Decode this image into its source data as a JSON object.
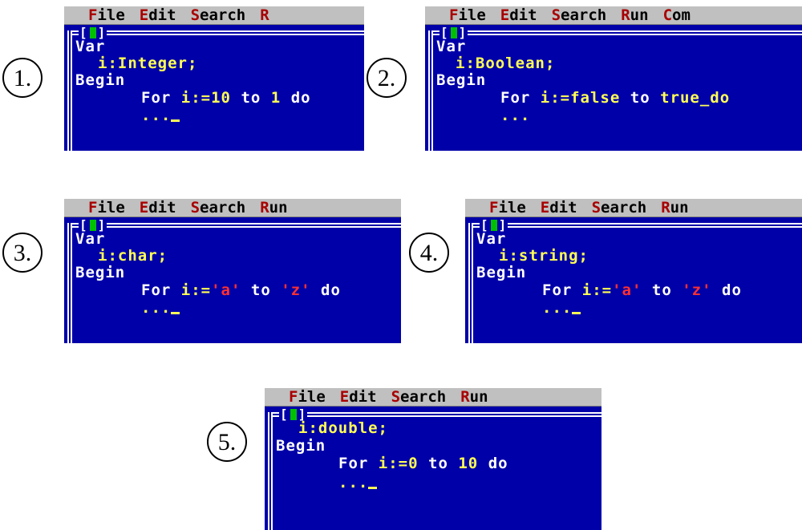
{
  "panels": [
    {
      "number": "1.",
      "menu": [
        {
          "hotkey": "F",
          "rest": "ile"
        },
        {
          "hotkey": "E",
          "rest": "dit"
        },
        {
          "hotkey": "S",
          "rest": "earch"
        },
        {
          "hotkey": "R",
          "rest": ""
        }
      ],
      "line1": "Var",
      "decl": "i:Integer;",
      "begin": "Begin",
      "for_kw": "For",
      "for_var": "i:=10",
      "for_to": "to",
      "for_end": "1",
      "for_do": "do",
      "dots": "..."
    },
    {
      "number": "2.",
      "menu": [
        {
          "hotkey": "F",
          "rest": "ile"
        },
        {
          "hotkey": "E",
          "rest": "dit"
        },
        {
          "hotkey": "S",
          "rest": "earch"
        },
        {
          "hotkey": "R",
          "rest": "un"
        },
        {
          "hotkey": "C",
          "rest": "om"
        }
      ],
      "line1": "Var",
      "decl": "i:Boolean;",
      "begin": "Begin",
      "for_kw": "For",
      "for_var": "i:=false",
      "for_to": "to",
      "for_end": "true_do",
      "dots": "..."
    },
    {
      "number": "3.",
      "menu": [
        {
          "hotkey": "F",
          "rest": "ile"
        },
        {
          "hotkey": "E",
          "rest": "dit"
        },
        {
          "hotkey": "S",
          "rest": "earch"
        },
        {
          "hotkey": "R",
          "rest": "un"
        }
      ],
      "line1": "Var",
      "decl": "i:char;",
      "begin": "Begin",
      "for_kw": "For",
      "for_var": "i:=",
      "for_lit1": "'a'",
      "for_to": "to",
      "for_lit2": "'z'",
      "for_do": "do",
      "dots": "..."
    },
    {
      "number": "4.",
      "menu": [
        {
          "hotkey": "F",
          "rest": "ile"
        },
        {
          "hotkey": "E",
          "rest": "dit"
        },
        {
          "hotkey": "S",
          "rest": "earch"
        },
        {
          "hotkey": "R",
          "rest": "un"
        }
      ],
      "line1": "Var",
      "decl": "i:string;",
      "begin": "Begin",
      "for_kw": "For",
      "for_var": "i:=",
      "for_lit1": "'a'",
      "for_to": "to",
      "for_lit2": "'z'",
      "for_do": "do",
      "dots": "..."
    },
    {
      "number": "5.",
      "menu": [
        {
          "hotkey": "F",
          "rest": "ile"
        },
        {
          "hotkey": "E",
          "rest": "dit"
        },
        {
          "hotkey": "S",
          "rest": "earch"
        },
        {
          "hotkey": "R",
          "rest": "un"
        }
      ],
      "decl": "i:double;",
      "begin": "Begin",
      "for_kw": "For",
      "for_var": "i:=0",
      "for_to": "to",
      "for_end": "10",
      "for_do": "do",
      "dots": "..."
    }
  ],
  "colors": {
    "editor_bg": "#0000a8",
    "menu_bg": "#c0c0c0",
    "hotkey": "#a80000",
    "code_white": "#ffffff",
    "code_yellow": "#ffff55",
    "string_red": "#ff3030",
    "window_tag_green": "#00c000"
  },
  "window_tag": "[ ]"
}
